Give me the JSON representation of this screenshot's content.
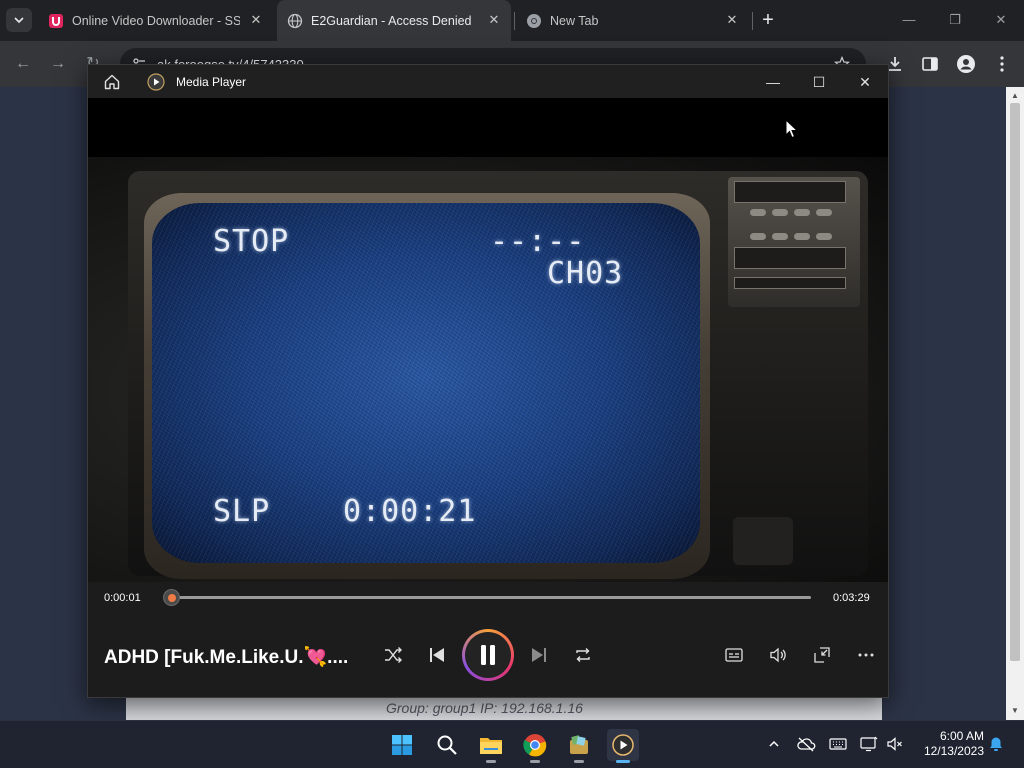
{
  "browser": {
    "tabs": [
      {
        "title": "Online Video Downloader - SSYo",
        "favicon": "ssyoutube-icon",
        "active": false
      },
      {
        "title": "E2Guardian - Access Denied",
        "favicon": "globe-icon",
        "active": true
      },
      {
        "title": "New Tab",
        "favicon": "chrome-icon",
        "active": false
      }
    ],
    "address": "ak.forooqso.tv/4/5742330",
    "page": {
      "group_line": "Group: group1   IP: 192.168.1.16"
    }
  },
  "media_player": {
    "window_title": "Media Player",
    "video_overlay": {
      "mode": "STOP",
      "clock": "--:--",
      "channel": "CH03",
      "speed": "SLP",
      "counter": "0:00:21"
    },
    "elapsed": "0:00:01",
    "duration": "0:03:29",
    "progress_fraction": 0.005,
    "now_playing": "ADHD [Fuk.Me.Like.U.💘....",
    "accent_color": "#f07c45"
  },
  "taskbar": {
    "apps": [
      "windows-start-icon",
      "search-icon",
      "file-explorer-icon",
      "chrome-icon",
      "store-icon",
      "media-player-icon"
    ],
    "time": "6:00 AM",
    "date": "12/13/2023"
  }
}
